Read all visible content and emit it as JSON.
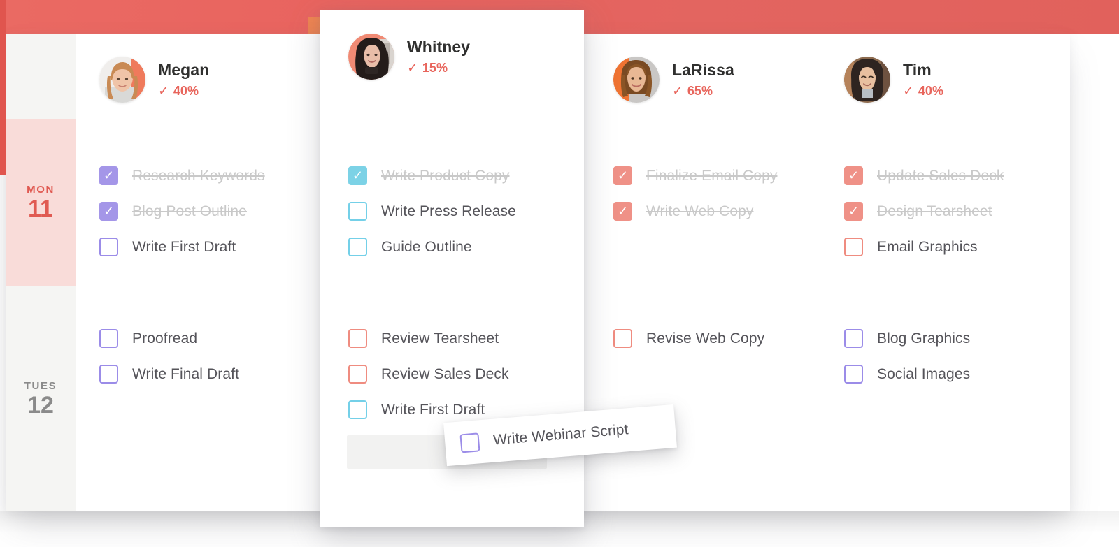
{
  "banner": {
    "color": "#e8645f",
    "accent_strip_color": "#e0554e"
  },
  "days": [
    {
      "id": "mon",
      "dow": "MON",
      "num": "11",
      "active": true,
      "bg": "#f9dcd9",
      "text_color": "#e05a52"
    },
    {
      "id": "tues",
      "dow": "TUES",
      "num": "12",
      "active": false,
      "bg": "#f5f5f3",
      "text_color": "#8a8a8a"
    }
  ],
  "check_glyph": "✓",
  "columns": [
    {
      "id": "megan",
      "name": "Megan",
      "percent": "40%",
      "percent_check": "✓",
      "accent": "purple",
      "accent_color": "#9b8ce8",
      "avatar_name": "avatar-megan",
      "mon_tasks": [
        {
          "label": "Research Keywords",
          "done": true
        },
        {
          "label": "Blog Post Outline",
          "done": true
        },
        {
          "label": "Write First Draft",
          "done": false
        }
      ],
      "tues_tasks": [
        {
          "label": "Proofread",
          "done": false
        },
        {
          "label": "Write Final Draft",
          "done": false
        }
      ]
    },
    {
      "id": "whitney",
      "name": "Whitney",
      "percent": "15%",
      "percent_check": "✓",
      "accent": "teal",
      "accent_color": "#74d0e8",
      "avatar_name": "avatar-whitney",
      "mon_tasks": [
        {
          "label": "Write Product Copy",
          "done": true
        },
        {
          "label": "Write Press Release",
          "done": false
        },
        {
          "label": "Guide Outline",
          "done": false
        }
      ],
      "tues_tasks": [
        {
          "label": "Review Tearsheet",
          "done": false,
          "accent": "coral"
        },
        {
          "label": "Review Sales Deck",
          "done": false,
          "accent": "coral"
        },
        {
          "label": "Write First Draft",
          "done": false,
          "accent": "teal"
        }
      ]
    },
    {
      "id": "larissa",
      "name": "LaRissa",
      "percent": "65%",
      "percent_check": "✓",
      "accent": "coral",
      "accent_color": "#ef8c80",
      "avatar_name": "avatar-larissa",
      "mon_tasks": [
        {
          "label": "Finalize Email Copy",
          "done": true
        },
        {
          "label": "Write Web Copy",
          "done": true
        }
      ],
      "tues_tasks": [
        {
          "label": "Revise Web Copy",
          "done": false
        }
      ]
    },
    {
      "id": "tim",
      "name": "Tim",
      "percent": "40%",
      "percent_check": "✓",
      "accent": "coral",
      "accent_color": "#ef8c80",
      "avatar_name": "avatar-tim",
      "mon_tasks": [
        {
          "label": "Update Sales Deck",
          "done": true
        },
        {
          "label": "Design Tearsheet",
          "done": true
        },
        {
          "label": "Email Graphics",
          "done": false,
          "accent": "coral"
        }
      ],
      "tues_tasks": [
        {
          "label": "Blog Graphics",
          "done": false,
          "accent": "purple"
        },
        {
          "label": "Social Images",
          "done": false,
          "accent": "purple"
        }
      ]
    }
  ],
  "drag_card": {
    "label": "Write Webinar Script",
    "done": false,
    "accent": "purple"
  }
}
